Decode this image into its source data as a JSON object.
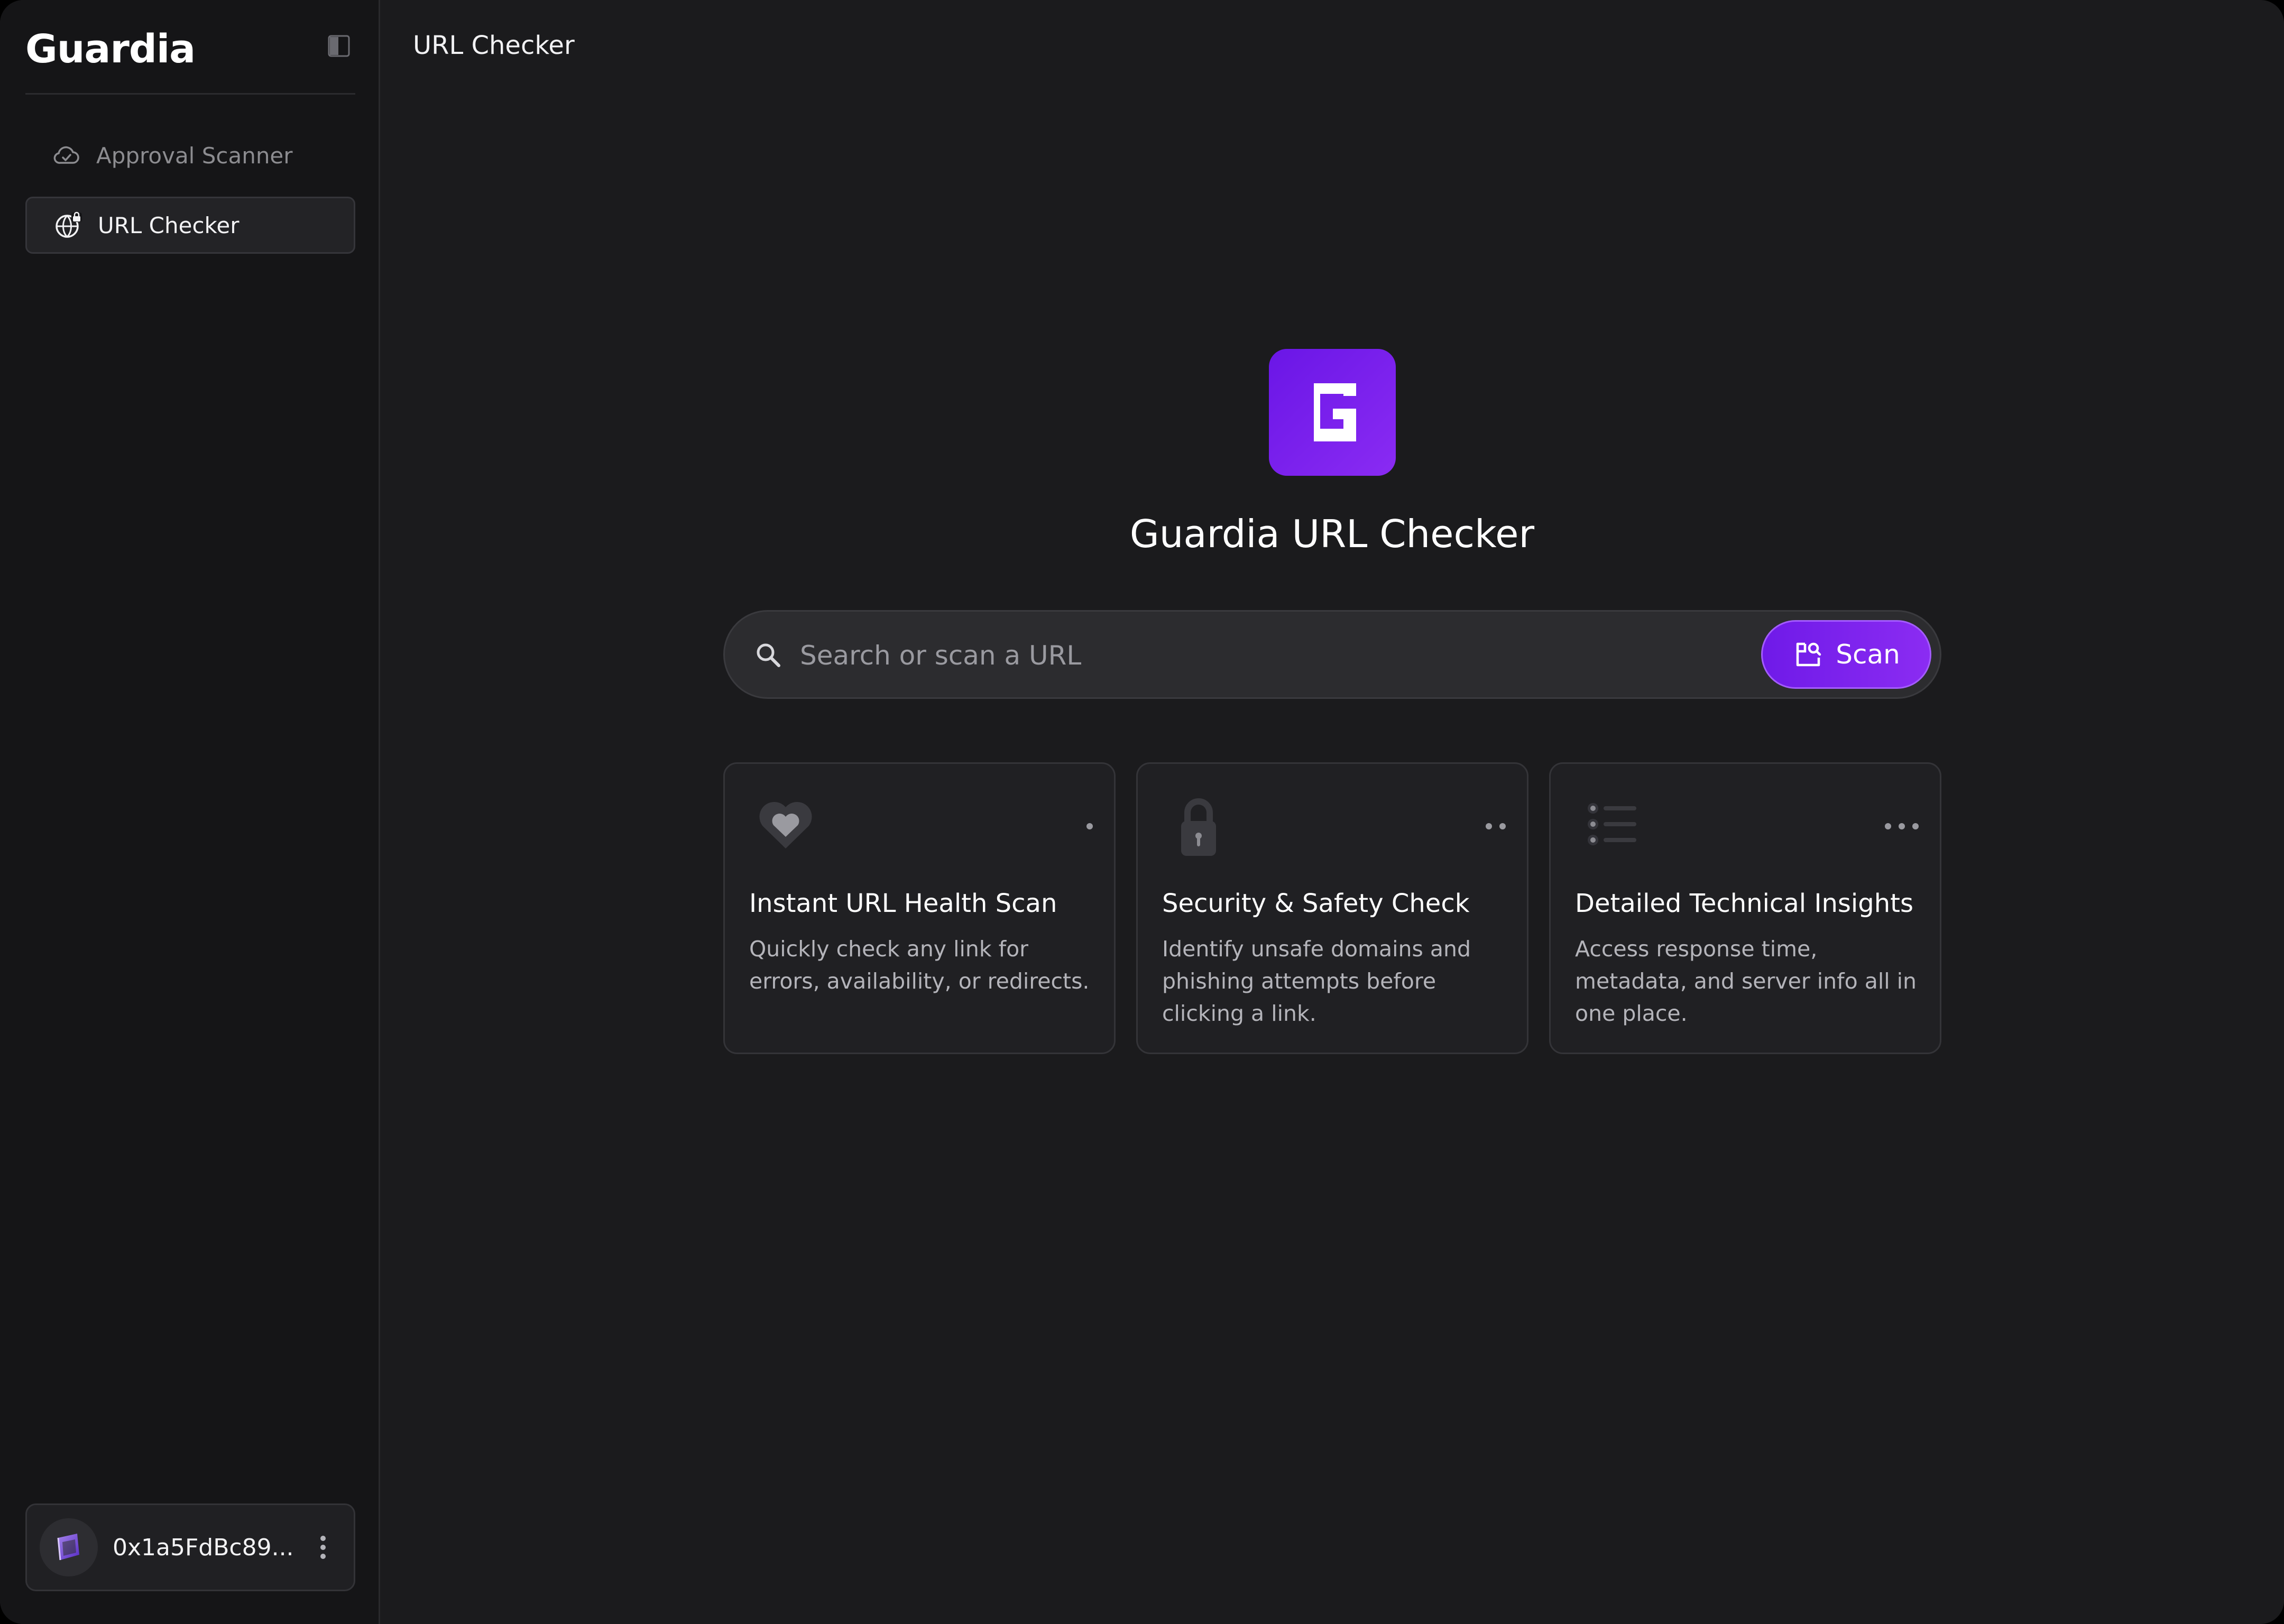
{
  "app": {
    "logo": "Guardia"
  },
  "sidebar": {
    "items": [
      {
        "label": "Approval Scanner",
        "icon": "cloud-check-icon",
        "active": false
      },
      {
        "label": "URL Checker",
        "icon": "globe-lock-icon",
        "active": true
      }
    ],
    "wallet": {
      "address": "0x1a5FdBc89...",
      "icon": "wallet-avatar-icon"
    }
  },
  "header": {
    "title": "URL Checker"
  },
  "hero": {
    "title": "Guardia URL Checker"
  },
  "search": {
    "placeholder": "Search or scan a URL",
    "value": "",
    "button_label": "Scan"
  },
  "cards": [
    {
      "title": "Instant URL Health Scan",
      "description": "Quickly check any link for errors, availability, or redirects.",
      "icon": "heart-icon",
      "dots": 1
    },
    {
      "title": "Security & Safety Check",
      "description": "Identify unsafe domains and phishing attempts before clicking a link.",
      "icon": "lock-icon",
      "dots": 2
    },
    {
      "title": "Detailed Technical Insights",
      "description": "Access response time, metadata, and server info all in one place.",
      "icon": "list-icon",
      "dots": 3
    }
  ],
  "colors": {
    "background": "#1b1b1d",
    "sidebar": "#151517",
    "accent": "#7b22ee",
    "card": "#202023"
  }
}
